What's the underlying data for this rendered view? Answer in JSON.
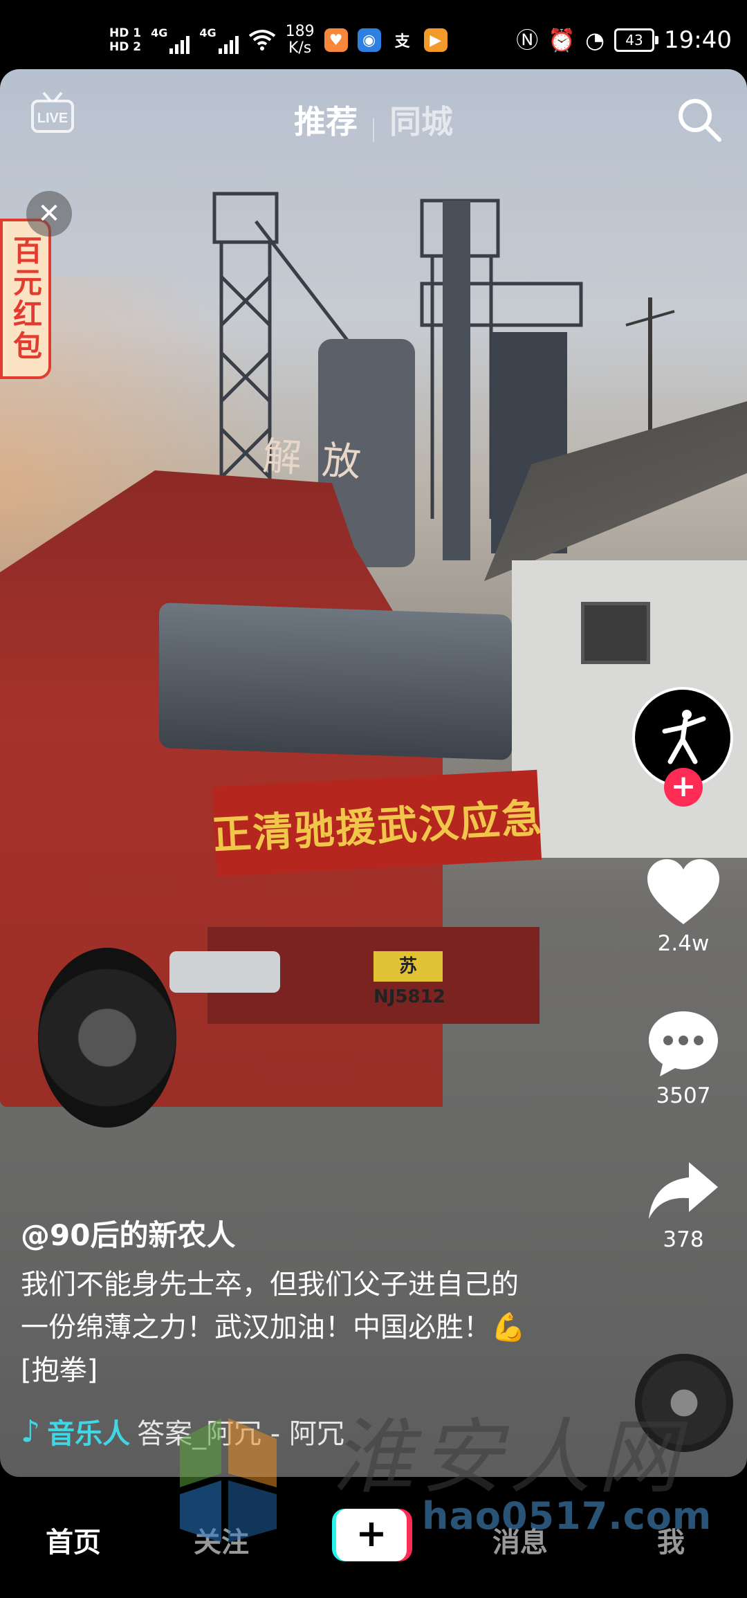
{
  "status_bar": {
    "hd1": "HD 1",
    "hd2": "HD 2",
    "net1": "4G",
    "net2": "4G",
    "speed_value": "189",
    "speed_unit": "K/s",
    "alipay_glyph": "支",
    "battery": "43",
    "time": "19:40"
  },
  "top_nav": {
    "live_label": "LIVE",
    "tabs": [
      {
        "label": "推荐",
        "active": true
      },
      {
        "label": "同城",
        "active": false
      }
    ]
  },
  "red_packet": {
    "label": "百元红包"
  },
  "video": {
    "banner_text": "建湖正清驰援武汉应急物资",
    "plate_text": "苏NJ5812",
    "grille_brand": "解放"
  },
  "rail": {
    "likes": "2.4w",
    "comments": "3507",
    "shares": "378"
  },
  "caption": {
    "author": "@90后的新农人",
    "description": "我们不能身先士卒，但我们父子进自己的一份绵薄之力！武汉加油！中国必胜！💪[抱拳]",
    "music_artist": "音乐人",
    "music_title": "答案_阿冗 - 阿冗"
  },
  "bottom_nav": {
    "items": [
      "首页",
      "关注",
      "消息",
      "我"
    ],
    "active_index": 0
  },
  "watermark": {
    "text": "淮安人网",
    "url": "hao0517.com"
  },
  "colors": {
    "accent_red": "#fe2c55",
    "accent_cyan": "#25f4ee",
    "music_cyan": "#3fd6e6"
  }
}
